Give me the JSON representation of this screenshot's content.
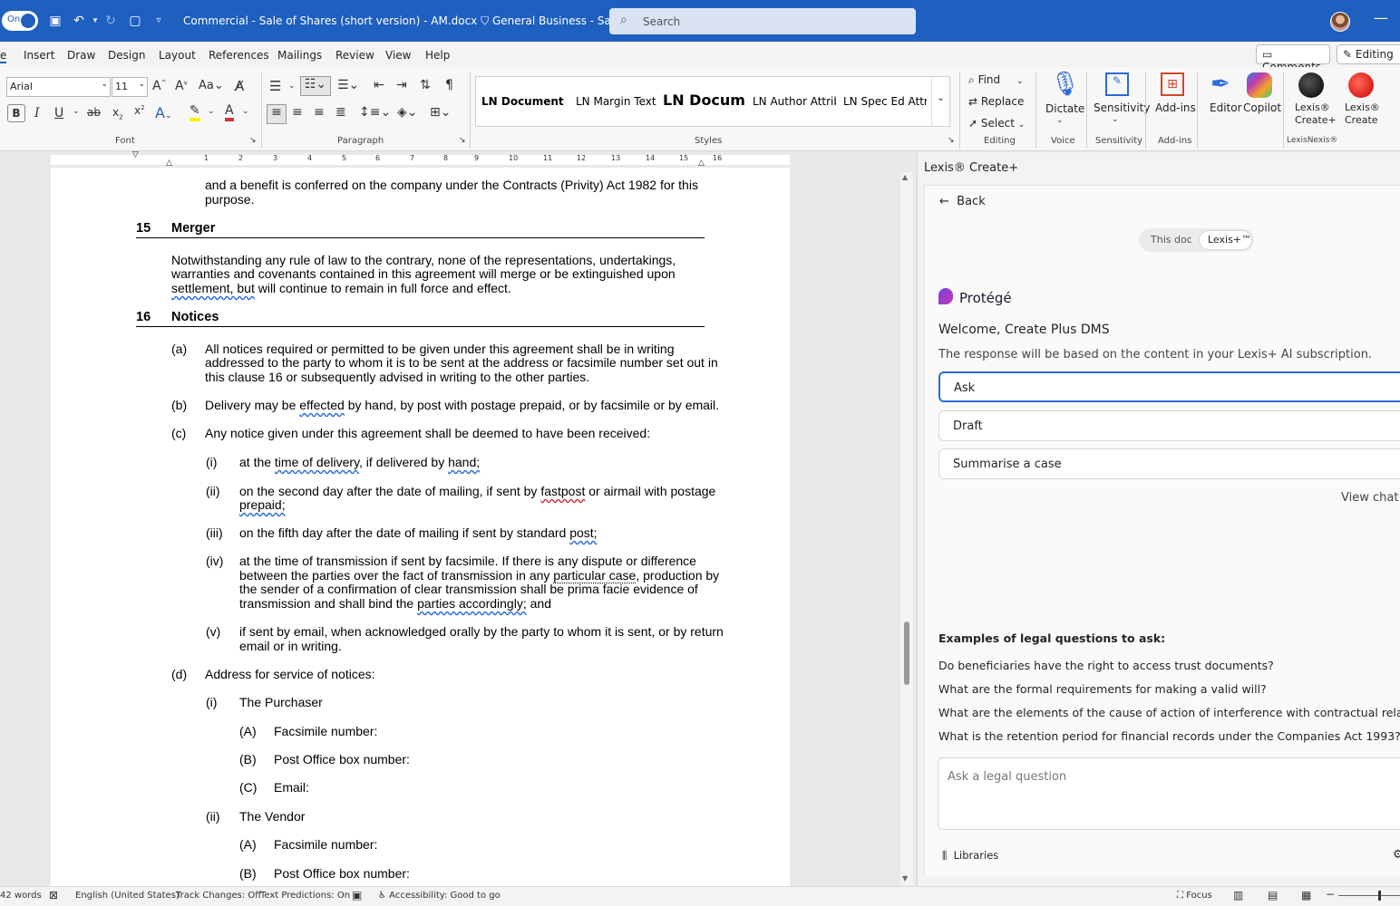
{
  "titlebar": {
    "toggle_label": "On",
    "doc_title": "Commercial - Sale of Shares (short version) - AM.docx",
    "label": "General Business - Saved",
    "search_placeholder": "Search"
  },
  "tabs": [
    "e",
    "Insert",
    "Draw",
    "Design",
    "Layout",
    "References",
    "Mailings",
    "Review",
    "View",
    "Help"
  ],
  "right_buttons": {
    "comments": "Comments",
    "editing": "Editing"
  },
  "ribbon": {
    "font_name": "Arial",
    "font_size": "11",
    "groups": {
      "font": "Font",
      "paragraph": "Paragraph",
      "styles": "Styles",
      "editing": "Editing",
      "voice": "Voice",
      "sensitivity": "Sensitivity",
      "addins": "Add-ins",
      "lexisnexis": "LexisNexis®"
    },
    "styles": [
      "LN Document N",
      "LN Margin Text",
      "LN Docum",
      "LN Author Attrib",
      "LN Spec Ed Attri"
    ],
    "editing": {
      "find": "Find",
      "replace": "Replace",
      "select": "Select"
    },
    "big_buttons": {
      "dictate": "Dictate",
      "sensitivity": "Sensitivity",
      "addins": "Add-ins",
      "editor": "Editor",
      "copilot": "Copilot",
      "lexis_create_plus_1": "Lexis®",
      "lexis_create_plus_2": "Create+",
      "lexis_create_1": "Lexis®",
      "lexis_create_2": "Create"
    }
  },
  "ruler": [
    "1",
    "2",
    "3",
    "4",
    "5",
    "6",
    "7",
    "8",
    "9",
    "10",
    "11",
    "12",
    "13",
    "14",
    "15",
    "16"
  ],
  "document": {
    "para0_l1": "and a benefit is conferred on the company under the Contracts (Privity) Act 1982 for this",
    "para0_l2": "purpose.",
    "h15_num": "15",
    "h15": "Merger",
    "merger_l1": "Notwithstanding any rule of law to the contrary, none of the representations, undertakings,",
    "merger_l2": "warranties and covenants contained in this agreement will merge or be extinguished upon",
    "merger_l3a": "settlement, but",
    "merger_l3b": " will continue to remain in full force and effect.",
    "h16_num": "16",
    "h16": "Notices",
    "a_m": "(a)",
    "a_l1": "All notices required or permitted to be given under this agreement shall be in writing",
    "a_l2": "addressed to the party to whom it is to be sent at the address or facsimile number set out in",
    "a_l3": "this clause 16 or subsequently advised in writing to the other parties.",
    "b_m": "(b)",
    "b_l1a": "Delivery may be ",
    "b_l1b": "effected",
    "b_l1c": " by hand, by post with postage prepaid, or by facsimile or by email.",
    "c_m": "(c)",
    "c_l1": "Any notice given under this agreement shall be deemed to have been received:",
    "i_m": "(i)",
    "i_l1a": "at the ",
    "i_l1b": "time of delivery",
    "i_l1c": ", if delivered by ",
    "i_l1d": "hand;",
    "ii_m": "(ii)",
    "ii_l1a": "on the second day after the date of mailing, if sent by ",
    "ii_l1b": "fastpost",
    "ii_l1c": " or airmail with postage",
    "ii_l2": "prepaid;",
    "iii_m": "(iii)",
    "iii_l1a": "on the fifth day after the date of mailing if sent by standard ",
    "iii_l1b": "post;",
    "iv_m": "(iv)",
    "iv_l1": "at the time of transmission if sent by facsimile. If there is any dispute or difference",
    "iv_l2a": "between the parties over the fact of transmission in any ",
    "iv_l2b": "particular case",
    "iv_l2c": ", production by",
    "iv_l3": "the sender of a confirmation of clear transmission shall be prima facie evidence of",
    "iv_l4a": "transmission and shall bind the ",
    "iv_l4b": "parties accordingly;",
    "iv_l4c": " and",
    "v_m": "(v)",
    "v_l1": "if sent by email, when acknowledged orally by the party to whom it is sent, or by return",
    "v_l2": "email or in writing.",
    "d_m": "(d)",
    "d_l1": "Address for service of notices:",
    "di_m": "(i)",
    "di_l1": "The Purchaser",
    "A1_m": "(A)",
    "A1": "Facsimile number:",
    "B1_m": "(B)",
    "B1": "Post Office box number:",
    "C1_m": "(C)",
    "C1": "Email:",
    "dii_m": "(ii)",
    "dii_l1": "The Vendor",
    "A2_m": "(A)",
    "A2": "Facsimile number:",
    "B2_m": "(B)",
    "B2": "Post Office box number:"
  },
  "pane": {
    "title": "Lexis® Create+",
    "back": "Back",
    "seg_this_doc": "This doc",
    "seg_lexis": "Lexis+™",
    "brand": "Protégé",
    "welcome": "Welcome, Create Plus DMS",
    "subtitle": "The response will be based on the content in your Lexis+ AI subscription.",
    "options": [
      "Ask",
      "Draft",
      "Summarise a case"
    ],
    "view_chat": "View chat h",
    "examples_title": "Examples of legal questions to ask:",
    "examples": [
      "Do beneficiaries have the right to access trust documents?",
      "What are the formal requirements for making a valid will?",
      "What are the elements of the cause of action of interference with contractual relations?",
      "What is the retention period for financial records under the Companies Act 1993?"
    ],
    "input_placeholder": "Ask a legal question",
    "libraries": "Libraries"
  },
  "status": {
    "words": "42 words",
    "language": "English (United States)",
    "track": "Track Changes: Off",
    "predictions": "Text Predictions: On",
    "accessibility": "Accessibility: Good to go",
    "focus": "Focus"
  },
  "colors": {
    "titlebar": "#1f5fbf",
    "accent": "#1f5fbf"
  }
}
